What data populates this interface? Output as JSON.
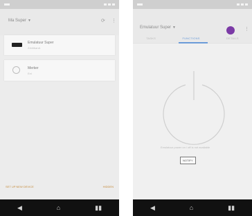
{
  "left_screen": {
    "appbar": {
      "title": "Ma Super"
    },
    "devices": [
      {
        "name": "Emulatuur Super",
        "subtitle": "ZrkhlbanA"
      },
      {
        "name": "Merker",
        "subtitle": "Ext"
      }
    ],
    "footer": {
      "left_link": "SET UP NEW DEVICE",
      "right_link": "HIDDEN"
    }
  },
  "right_screen": {
    "appbar": {
      "title": "Emulatuur Super"
    },
    "tabs": [
      {
        "label": "Tasks",
        "active": false
      },
      {
        "label": "Functions",
        "active": true
      },
      {
        "label": "Details",
        "active": false
      }
    ],
    "status_message": "Emulatuur power on / off is not available",
    "button_label": "NOTIFY"
  },
  "colors": {
    "accent": "#6a9bd8",
    "avatar": "#7b3aa6",
    "link": "#c48a3a",
    "navbar": "#111111"
  }
}
